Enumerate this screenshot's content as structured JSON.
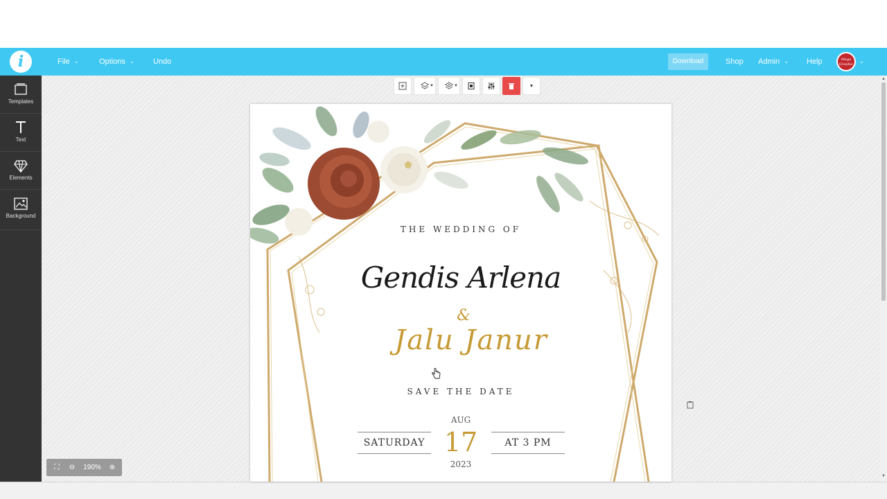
{
  "app": {
    "logo_letter": "i",
    "brand_color": "#3ec8f2"
  },
  "topbar": {
    "file": "File",
    "options": "Options",
    "undo": "Undo",
    "download": "Download",
    "shop": "Shop",
    "admin": "Admin",
    "help": "Help",
    "avatar_text": "Mega Graphic"
  },
  "sidebar": {
    "items": [
      {
        "label": "Templates",
        "icon": "templates-icon"
      },
      {
        "label": "Text",
        "icon": "text-icon"
      },
      {
        "label": "Elements",
        "icon": "diamond-icon"
      },
      {
        "label": "Background",
        "icon": "image-icon"
      }
    ]
  },
  "toolbar": {
    "tools": [
      "duplicate-icon",
      "layer-forward-icon",
      "layer-backward-icon",
      "lock-icon",
      "adjust-icon",
      "delete-icon",
      "more-icon"
    ],
    "delete_color": "#e84a4a"
  },
  "invitation": {
    "heading": "THE WEDDING OF",
    "name1": "Gendis Arlena",
    "ampersand": "&",
    "name2": "Jalu Janur",
    "save_the_date": "SAVE THE DATE",
    "month": "AUG",
    "day": "17",
    "year": "2023",
    "weekday": "SATURDAY",
    "time": "AT 3 PM",
    "gold_color": "#c69a34"
  },
  "zoom": {
    "level": "190%"
  }
}
